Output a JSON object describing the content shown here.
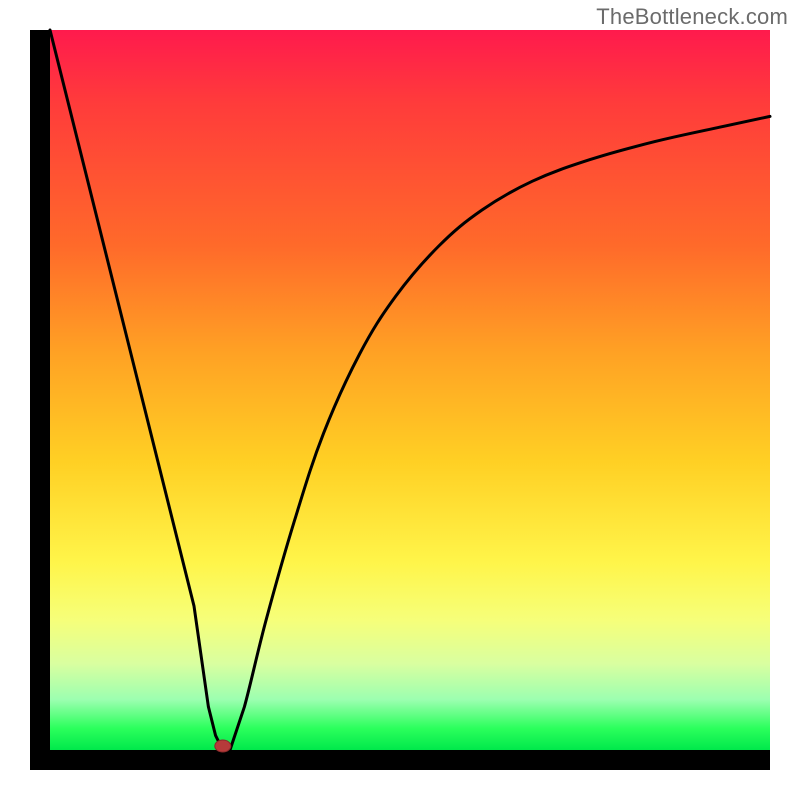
{
  "watermark": "TheBottleneck.com",
  "chart_data": {
    "type": "line",
    "title": "",
    "xlabel": "",
    "ylabel": "",
    "xlim": [
      0,
      100
    ],
    "ylim": [
      0,
      100
    ],
    "grid": false,
    "series": [
      {
        "name": "curve",
        "x": [
          0,
          5,
          10,
          15,
          20,
          22,
          23,
          24,
          25,
          27,
          30,
          34,
          38,
          43,
          48,
          54,
          60,
          67,
          75,
          84,
          93,
          100
        ],
        "values": [
          100,
          80,
          60,
          40,
          20,
          6,
          2,
          0,
          0,
          6,
          18,
          32,
          44,
          55,
          63,
          70,
          75,
          79,
          82,
          84.5,
          86.5,
          88
        ]
      }
    ],
    "marker": {
      "x": 24,
      "y": 0,
      "color": "#b63a3a"
    },
    "gradient_stops": [
      {
        "pct": 0,
        "color": "#ff1a4d"
      },
      {
        "pct": 10,
        "color": "#ff3b3b"
      },
      {
        "pct": 30,
        "color": "#ff6a2a"
      },
      {
        "pct": 45,
        "color": "#ffa224"
      },
      {
        "pct": 60,
        "color": "#ffd024"
      },
      {
        "pct": 74,
        "color": "#fff54a"
      },
      {
        "pct": 82,
        "color": "#f6ff7a"
      },
      {
        "pct": 88,
        "color": "#d9ffa0"
      },
      {
        "pct": 93,
        "color": "#9cffb0"
      },
      {
        "pct": 97,
        "color": "#2bff5c"
      },
      {
        "pct": 100,
        "color": "#00e84b"
      }
    ]
  }
}
